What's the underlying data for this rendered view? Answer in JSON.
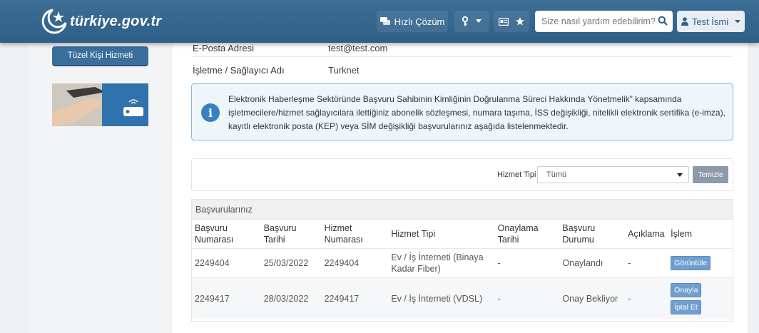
{
  "header": {
    "logo_text": "türkiye.gov.tr",
    "hizli_cozum": "Hızlı Çözüm",
    "search_placeholder": "Size nasıl yardım edebilirim?",
    "user_name": "Test İsmi"
  },
  "sidebar": {
    "service_button": "Tüzel Kişi Hizmeti"
  },
  "fields": [
    {
      "label": "E-Posta Adresi",
      "value": "test@test.com"
    },
    {
      "label": "İşletme / Sağlayıcı Adı",
      "value": "Turknet"
    }
  ],
  "info": {
    "text": "Elektronik Haberleşme Sektöründe Başvuru Sahibinin Kimliğinin Doğrulanma Süreci Hakkında Yönetmelik” kapsamında işletmecilere/hizmet sağlayıcılara ilettiğiniz abonelik sözleşmesi, numara taşıma, İSS değişikliği, nitelikli elektronik sertifika (e-imza), kayıtlı elektronik posta (KEP) veya SİM değişikliği başvurularınız aşağıda listelenmektedir."
  },
  "filter": {
    "label": "Hizmet Tipi",
    "selected": "Tümü",
    "clear_button": "Temizle"
  },
  "table": {
    "title": "Başvurularınız",
    "headers": [
      "Başvuru Numarası",
      "Başvuru Tarihi",
      "Hizmet Numarası",
      "Hizmet Tipi",
      "Onaylama Tarihi",
      "Başvuru Durumu",
      "Açıklama",
      "İşlem"
    ],
    "rows": [
      {
        "basvuru_no": "2249404",
        "tarih": "25/03/2022",
        "hizmet_no": "2249404",
        "hizmet_tipi": "Ev / İş İnterneti (Binaya Kadar Fiber)",
        "onay_tarihi": "-",
        "durum": "Onaylandı",
        "aciklama": "-",
        "actions": [
          "Görüntüle"
        ]
      },
      {
        "basvuru_no": "2249417",
        "tarih": "28/03/2022",
        "hizmet_no": "2249417",
        "hizmet_tipi": "Ev / İş İnterneti (VDSL)",
        "onay_tarihi": "-",
        "durum": "Onay Bekliyor",
        "aciklama": "-",
        "actions": [
          "Onayla",
          "İptal Et"
        ]
      }
    ]
  },
  "colors": {
    "header_bg": "#2f5f86",
    "primary_button": "#3b6e9a",
    "action_button": "#6f9fd0"
  }
}
